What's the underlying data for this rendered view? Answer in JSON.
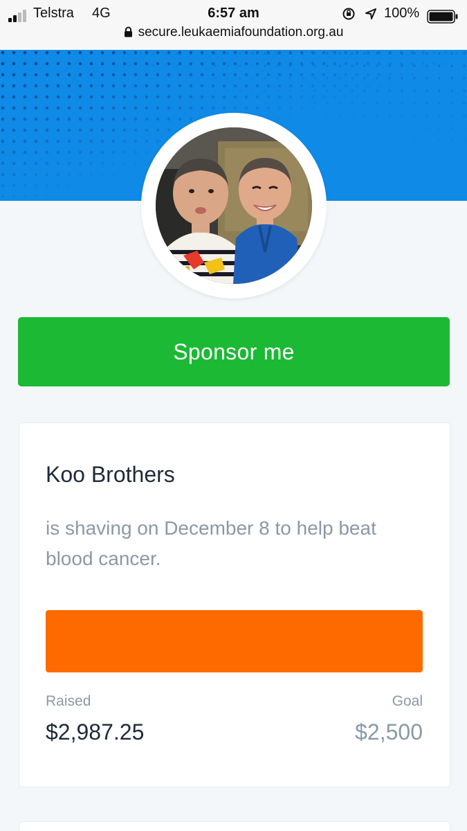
{
  "status_bar": {
    "carrier": "Telstra",
    "network": "4G",
    "time": "6:57 am",
    "battery_percent": "100%",
    "url": "secure.leukaemiafoundation.org.au"
  },
  "colors": {
    "header_blue": "#0f8ae6",
    "sponsor_green": "#1bb934",
    "progress_orange": "#ff6a00"
  },
  "profile": {
    "cta_label": "Sponsor me",
    "name": "Koo Brothers",
    "description": "is shaving on December 8 to help beat blood cancer.",
    "raised_label": "Raised",
    "raised_amount": "$2,987.25",
    "goal_label": "Goal",
    "goal_amount": "$2,500",
    "progress_fraction": 1.0
  }
}
